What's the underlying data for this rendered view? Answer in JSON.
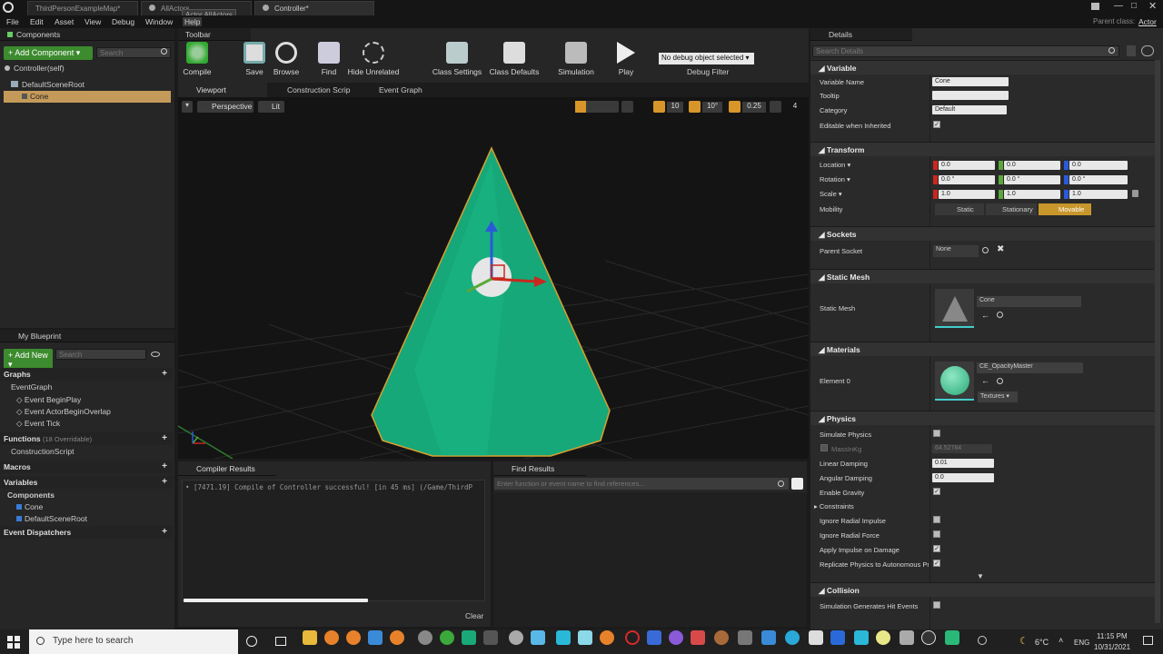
{
  "titlebar": {
    "tabs": [
      "ThirdPersonExampleMap*",
      "AllActors",
      "Controller*"
    ],
    "tooltip": "Actor AllActors",
    "parent_class_label": "Parent class:",
    "parent_class_value": "Actor"
  },
  "menu": [
    "File",
    "Edit",
    "Asset",
    "View",
    "Debug",
    "Window",
    "Help"
  ],
  "components_panel": {
    "title": "Components",
    "add_button": "+ Add Component ▾",
    "search_placeholder": "Search",
    "self_item": "Controller(self)",
    "tree": [
      "DefaultSceneRoot",
      "Cone"
    ]
  },
  "my_blueprint": {
    "title": "My Blueprint",
    "add_button": "+ Add New ▾",
    "search_placeholder": "Search",
    "graphs_label": "Graphs",
    "event_graph": "EventGraph",
    "events": [
      "Event BeginPlay",
      "Event ActorBeginOverlap",
      "Event Tick"
    ],
    "functions_label": "Functions",
    "functions_hint": "(18 Overridable)",
    "construction_script": "ConstructionScript",
    "macros_label": "Macros",
    "variables_label": "Variables",
    "components_label": "Components",
    "var_components": [
      "Cone",
      "DefaultSceneRoot"
    ],
    "dispatchers_label": "Event Dispatchers"
  },
  "toolbar": {
    "title": "Toolbar",
    "buttons": [
      "Compile",
      "Save",
      "Browse",
      "Find",
      "Hide Unrelated",
      "Class Settings",
      "Class Defaults",
      "Simulation",
      "Play"
    ],
    "debug_object": "No debug object selected ▾",
    "debug_filter": "Debug Filter"
  },
  "editor_tabs": [
    "Viewport",
    "Construction Scrip",
    "Event Graph"
  ],
  "viewport": {
    "perspective": "Perspective",
    "lit": "Lit",
    "grid_snap": "10",
    "rot_snap": "10°",
    "scale_snap": "0.25",
    "cam_speed": "4"
  },
  "compiler_results": {
    "title": "Compiler Results",
    "message": "• [7471.19] Compile of Controller successful! [in 45 ms] (/Game/ThirdP",
    "clear": "Clear"
  },
  "find_results": {
    "title": "Find Results",
    "placeholder": "Enter function or event name to find references..."
  },
  "details": {
    "title": "Details",
    "search_placeholder": "Search Details",
    "variable": {
      "section": "Variable",
      "name_label": "Variable Name",
      "name_value": "Cone",
      "tooltip_label": "Tooltip",
      "category_label": "Category",
      "category_value": "Default",
      "editable_label": "Editable when Inherited"
    },
    "transform": {
      "section": "Transform",
      "location_label": "Location ▾",
      "location": [
        "0.0",
        "0.0",
        "0.0"
      ],
      "rotation_label": "Rotation ▾",
      "rotation": [
        "0.0 °",
        "0.0 °",
        "0.0 °"
      ],
      "scale_label": "Scale ▾",
      "scale": [
        "1.0",
        "1.0",
        "1.0"
      ],
      "mobility_label": "Mobility",
      "mobility_options": [
        "Static",
        "Stationary",
        "Movable"
      ]
    },
    "sockets": {
      "section": "Sockets",
      "parent_label": "Parent Socket",
      "parent_value": "None"
    },
    "static_mesh": {
      "section": "Static Mesh",
      "label": "Static Mesh",
      "value": "Cone"
    },
    "materials": {
      "section": "Materials",
      "label": "Element 0",
      "value": "CE_OpacityMaster",
      "textures": "Textures ▾"
    },
    "physics": {
      "section": "Physics",
      "simulate": "Simulate Physics",
      "mass_label": "MassInKg",
      "mass_value": "64.52784",
      "linear_label": "Linear Damping",
      "linear_value": "0.01",
      "angular_label": "Angular Damping",
      "angular_value": "0.0",
      "gravity": "Enable Gravity",
      "constraints": "Constraints",
      "radial_impulse": "Ignore Radial Impulse",
      "radial_force": "Ignore Radial Force",
      "impulse_damage": "Apply Impulse on Damage",
      "replicate": "Replicate Physics to Autonomous Pr"
    },
    "collision": {
      "section": "Collision",
      "hit_events": "Simulation Generates Hit Events"
    }
  },
  "taskbar": {
    "search_placeholder": "Type here to search",
    "temperature": "6°C",
    "language": "ENG",
    "time": "11:15 PM",
    "date": "10/31/2021"
  },
  "colors": {
    "accent_green": "#3c8b2e",
    "selection": "#c49a5a",
    "cone": "#16a878",
    "movable": "#c8962a"
  }
}
